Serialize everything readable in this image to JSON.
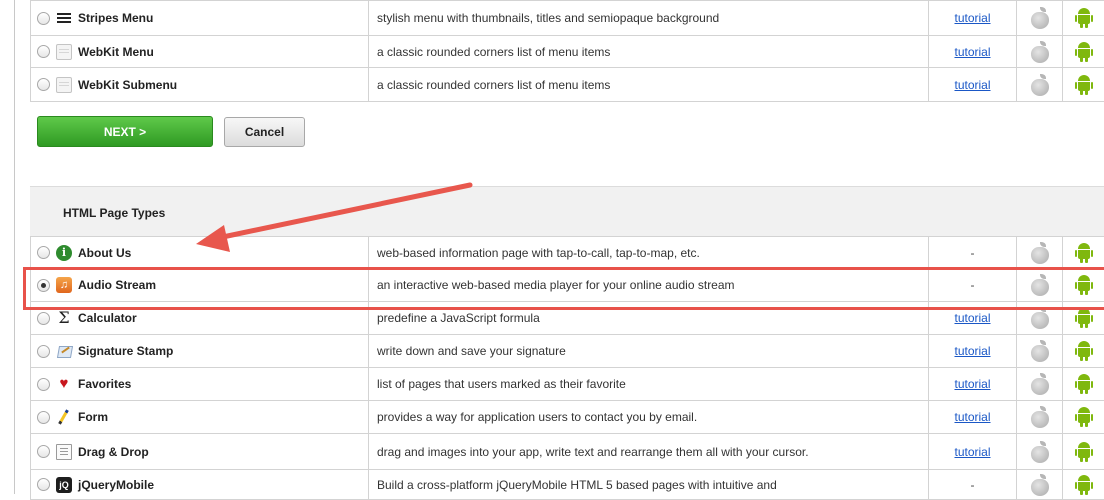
{
  "top_rows": [
    {
      "icon": "stripes-icon",
      "name": "Stripes Menu",
      "desc": "stylish menu with thumbnails, titles and semiopaque background",
      "link": "tutorial",
      "selected": false
    },
    {
      "icon": "webkit-menu-icon",
      "name": "WebKit Menu",
      "desc": "a classic rounded corners list of menu items",
      "link": "tutorial",
      "selected": false
    },
    {
      "icon": "webkit-menu-icon",
      "name": "WebKit Submenu",
      "desc": "a classic rounded corners list of menu items",
      "link": "tutorial",
      "selected": false
    }
  ],
  "buttons": {
    "next": "NEXT >",
    "cancel": "Cancel"
  },
  "section": {
    "title": "HTML Page Types"
  },
  "page_types": [
    {
      "icon": "info-icon",
      "name": "About Us",
      "desc": "web-based information page with tap-to-call, tap-to-map, etc.",
      "link": "-",
      "selected": false
    },
    {
      "icon": "audio-icon",
      "name": "Audio Stream",
      "desc": "an interactive web-based media player for your online audio stream",
      "link": "-",
      "selected": true
    },
    {
      "icon": "sigma-icon",
      "name": "Calculator",
      "desc": "predefine a JavaScript formula",
      "link": "tutorial",
      "selected": false
    },
    {
      "icon": "signature-icon",
      "name": "Signature Stamp",
      "desc": "write down and save your signature",
      "link": "tutorial",
      "selected": false
    },
    {
      "icon": "heart-icon",
      "name": "Favorites",
      "desc": "list of pages that users marked as their favorite",
      "link": "tutorial",
      "selected": false
    },
    {
      "icon": "pencil-icon",
      "name": "Form",
      "desc": "provides a way for application users to contact you by email.",
      "link": "tutorial",
      "selected": false
    },
    {
      "icon": "drag-icon",
      "name": "Drag & Drop",
      "desc": "drag and images into your app, write text and rearrange them all with your cursor.",
      "link": "tutorial",
      "selected": false
    },
    {
      "icon": "jquerymobile-icon",
      "name": "jQueryMobile",
      "desc": "Build a cross-platform jQueryMobile HTML 5 based pages with intuitive and",
      "link": "-",
      "selected": false
    }
  ],
  "platform_icons": [
    "apple-icon",
    "android-icon"
  ],
  "annotation_colors": {
    "arrow": "#e8574d",
    "highlight": "#e8524a"
  },
  "accent_colors": {
    "next_button": "#3aa82b",
    "link": "#1a57c6"
  }
}
